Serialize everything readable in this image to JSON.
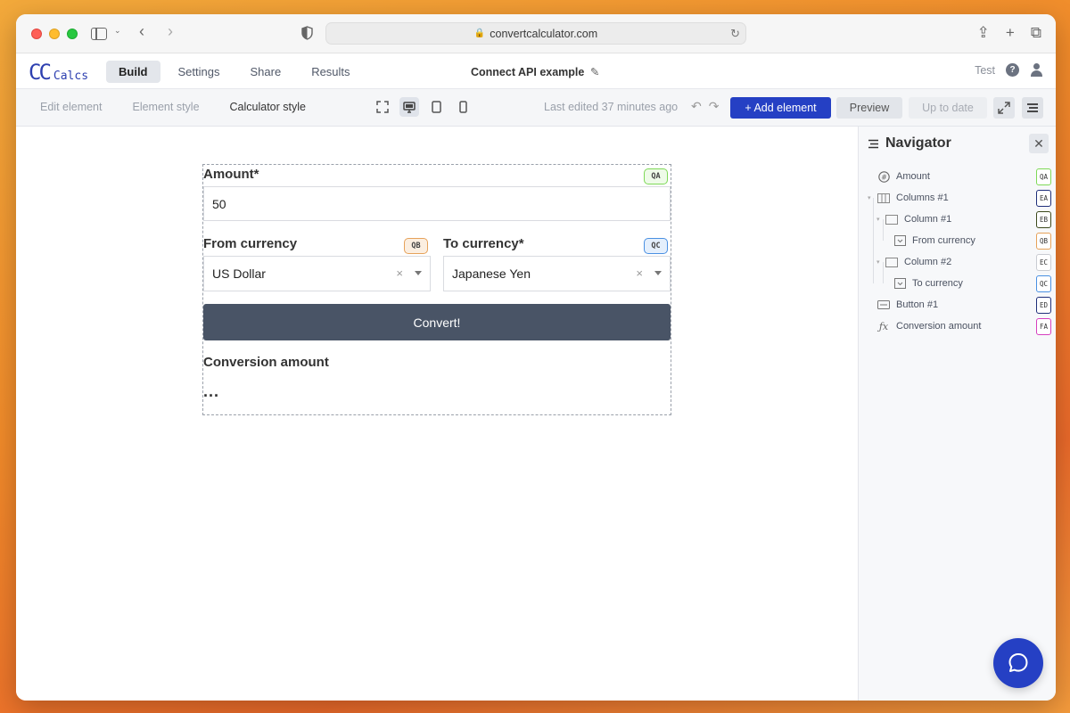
{
  "browser": {
    "url": "convertcalculator.com"
  },
  "app": {
    "logo_cc": "CC",
    "logo_calcs": "Calcs",
    "nav": [
      {
        "label": "Build",
        "active": true
      },
      {
        "label": "Settings",
        "active": false
      },
      {
        "label": "Share",
        "active": false
      },
      {
        "label": "Results",
        "active": false
      }
    ],
    "page_title": "Connect API example",
    "user_label": "Test",
    "help_glyph": "?"
  },
  "toolbar": {
    "tabs": [
      {
        "label": "Edit element",
        "active": false
      },
      {
        "label": "Element style",
        "active": false
      },
      {
        "label": "Calculator style",
        "active": true
      }
    ],
    "last_edited": "Last edited 37 minutes ago",
    "add_element": "+ Add element",
    "preview": "Preview",
    "up_to_date": "Up to date",
    "device_active": "desktop"
  },
  "calculator": {
    "amount": {
      "label": "Amount*",
      "value": "50",
      "tag": "QA"
    },
    "from_currency": {
      "label": "From currency",
      "value": "US Dollar",
      "tag": "QB"
    },
    "to_currency": {
      "label": "To currency*",
      "value": "Japanese Yen",
      "tag": "QC"
    },
    "convert_button": "Convert!",
    "result": {
      "label": "Conversion amount",
      "value": "..."
    }
  },
  "navigator": {
    "title": "Navigator",
    "items": [
      {
        "label": "Amount",
        "tag": "QA",
        "tag_color": "#7ed957",
        "icon": "hash-icon",
        "depth": 0
      },
      {
        "label": "Columns #1",
        "tag": "EA",
        "tag_color": "#1f2f7a",
        "icon": "columns-icon",
        "depth": 0
      },
      {
        "label": "Column #1",
        "tag": "EB",
        "tag_color": "#3d4a1d",
        "icon": "column-icon",
        "depth": 1
      },
      {
        "label": "From currency",
        "tag": "QB",
        "tag_color": "#e6a25a",
        "icon": "dropdown-icon",
        "depth": 2
      },
      {
        "label": "Column #2",
        "tag": "EC",
        "tag_color": "#c9ccd2",
        "icon": "column-icon",
        "depth": 1
      },
      {
        "label": "To currency",
        "tag": "QC",
        "tag_color": "#4a90e2",
        "icon": "dropdown-icon",
        "depth": 2
      },
      {
        "label": "Button #1",
        "tag": "ED",
        "tag_color": "#1f2f7a",
        "icon": "button-icon",
        "depth": 0
      },
      {
        "label": "Conversion amount",
        "tag": "FA",
        "tag_color": "#d63fbf",
        "icon": "formula-icon",
        "depth": 0
      }
    ]
  },
  "colors": {
    "brand": "#2540c4",
    "button": "#495466"
  }
}
